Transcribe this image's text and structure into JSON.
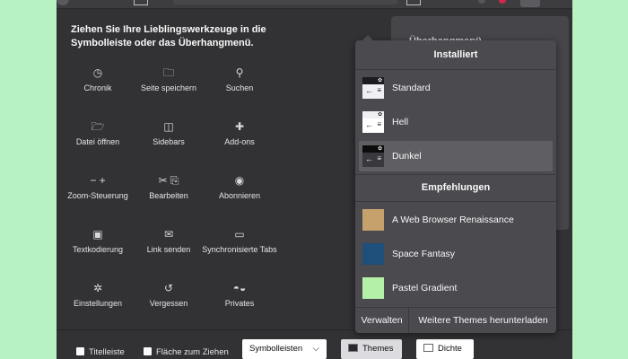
{
  "palette": {
    "title": "Ziehen Sie Ihre Lieblingswerkzeuge in die Symbolleiste oder das Überhangmenü.",
    "tools": [
      {
        "id": "history",
        "label": "Chronik",
        "icon": "clock-icon",
        "glyph": "◷"
      },
      {
        "id": "save-page",
        "label": "Seite speichern",
        "icon": "save-page-icon",
        "glyph": "🗀"
      },
      {
        "id": "search",
        "label": "Suchen",
        "icon": "search-icon",
        "glyph": "⚲"
      },
      {
        "id": "open-file",
        "label": "Datei öffnen",
        "icon": "open-file-icon",
        "glyph": "🗁"
      },
      {
        "id": "sidebars",
        "label": "Sidebars",
        "icon": "sidebar-icon",
        "glyph": "◫"
      },
      {
        "id": "add-ons",
        "label": "Add-ons",
        "icon": "puzzle-icon",
        "glyph": "✚"
      },
      {
        "id": "zoom",
        "label": "Zoom-Steuerung",
        "icon": "zoom-icon",
        "glyph": "− +"
      },
      {
        "id": "edit",
        "label": "Bearbeiten",
        "icon": "edit-icon",
        "glyph": "✂ ⎘"
      },
      {
        "id": "subscribe",
        "label": "Abonnieren",
        "icon": "rss-icon",
        "glyph": "◉"
      },
      {
        "id": "encoding",
        "label": "Textkodierung",
        "icon": "text-encoding-icon",
        "glyph": "▣"
      },
      {
        "id": "send-link",
        "label": "Link senden",
        "icon": "mail-icon",
        "glyph": "✉"
      },
      {
        "id": "synced-tabs",
        "label": "Synchronisierte Tabs",
        "icon": "synced-tabs-icon",
        "glyph": "▭"
      },
      {
        "id": "preferences",
        "label": "Einstellungen",
        "icon": "gear-icon",
        "glyph": "✲"
      },
      {
        "id": "forget",
        "label": "Vergessen",
        "icon": "forget-icon",
        "glyph": "↺"
      },
      {
        "id": "private",
        "label": "Privates",
        "icon": "mask-icon",
        "glyph": "◓◒"
      }
    ]
  },
  "overflow": {
    "title": "Überhangmenü"
  },
  "themes_popup": {
    "installed_header": "Installiert",
    "installed": [
      {
        "label": "Standard",
        "icon": "default-theme-thumb",
        "bar": "#1c1b22",
        "bg": "#f0f0f4",
        "fg": "#1c1b22",
        "selected": false
      },
      {
        "label": "Hell",
        "icon": "light-theme-thumb",
        "bar": "#f0f0f4",
        "bg": "#ffffff",
        "fg": "#1c1b22",
        "selected": false
      },
      {
        "label": "Dunkel",
        "icon": "dark-theme-thumb",
        "bar": "#0c0c0d",
        "bg": "#38383d",
        "fg": "#f9f9fa",
        "selected": true
      }
    ],
    "recommended_header": "Empfehlungen",
    "recommended": [
      {
        "label": "A Web Browser Renaissance",
        "icon": "renaissance-theme-thumb",
        "color": "#c7a16b"
      },
      {
        "label": "Space Fantasy",
        "icon": "space-fantasy-theme-thumb",
        "color": "#1d4f7a"
      },
      {
        "label": "Pastel Gradient",
        "icon": "pastel-gradient-theme-thumb",
        "color": "#b5f0a8"
      }
    ],
    "manage_label": "Verwalten",
    "more_label": "Weitere Themes herunterladen"
  },
  "bottom_bar": {
    "titlebar_label": "Titelleiste",
    "drag_space_label": "Fläche zum Ziehen",
    "toolbars_label": "Symbolleisten",
    "themes_label": "Themes",
    "density_label": "Dichte"
  }
}
